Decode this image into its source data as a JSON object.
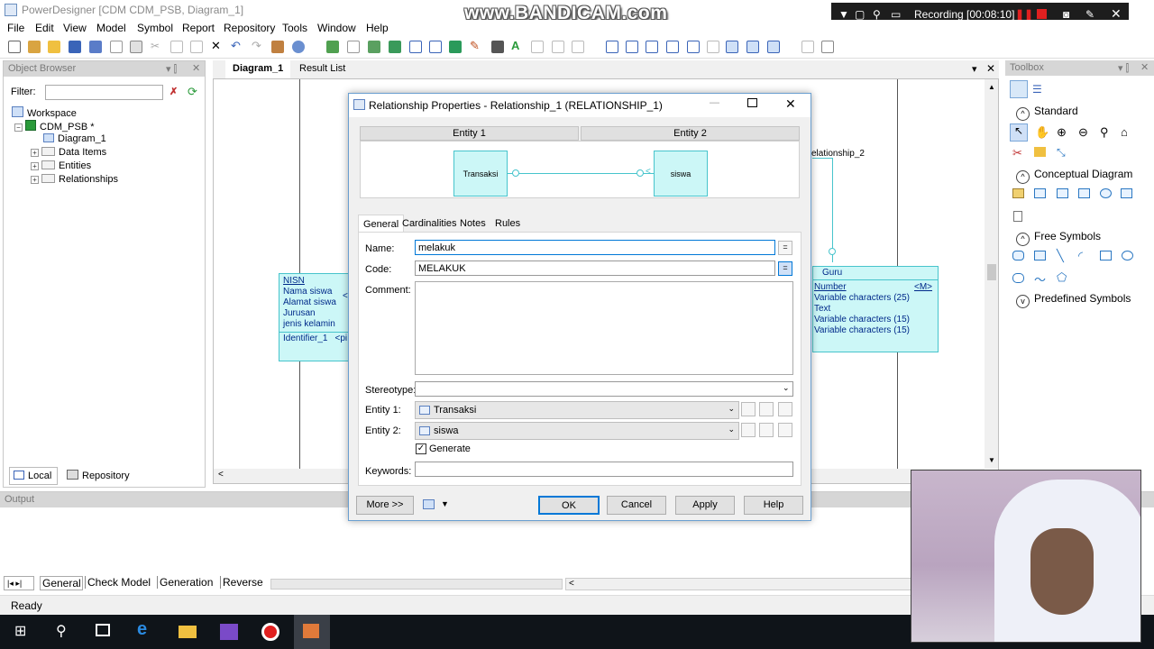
{
  "window": {
    "title": "PowerDesigner [CDM CDM_PSB, Diagram_1]"
  },
  "watermark": "www.BANDICAM.com",
  "recording": {
    "label": "Recording [00:08:10]"
  },
  "menu": [
    "File",
    "Edit",
    "View",
    "Model",
    "Symbol",
    "Report",
    "Repository",
    "Tools",
    "Window",
    "Help"
  ],
  "object_browser": {
    "title": "Object Browser",
    "filter_label": "Filter:",
    "filter_value": "",
    "tree": {
      "workspace": "Workspace",
      "model": "CDM_PSB *",
      "diagram": "Diagram_1",
      "data_items": "Data Items",
      "entities": "Entities",
      "relationships": "Relationships"
    },
    "tabs": {
      "local": "Local",
      "repository": "Repository"
    }
  },
  "diagram": {
    "tabs": [
      "Diagram_1",
      "Result List"
    ],
    "left_entity": {
      "attrs": [
        "NISN",
        "Nama siswa",
        "Alamat siswa",
        "Jurusan",
        "jenis kelamin"
      ],
      "identifier": "Identifier_1",
      "identifier_tag": "<pi",
      "pk_tag": "<"
    },
    "right_entity": {
      "name": "Guru",
      "types": [
        "Number",
        "Variable characters (25)",
        "Text",
        "Variable characters (15)",
        "Variable characters (15)"
      ],
      "mandatory_tag": "<M>"
    },
    "rel_label": "elationship_2"
  },
  "toolbox": {
    "title": "Toolbox",
    "sections": [
      "Standard",
      "Conceptual Diagram",
      "Free Symbols",
      "Predefined Symbols"
    ]
  },
  "output": {
    "title": "Output",
    "tabs": [
      "General",
      "Check Model",
      "Generation",
      "Reverse"
    ]
  },
  "status": "Ready",
  "dialog": {
    "title": "Relationship Properties - Relationship_1 (RELATIONSHIP_1)",
    "entity1_header": "Entity 1",
    "entity2_header": "Entity 2",
    "preview_entity1": "Transaksi",
    "preview_entity2": "siswa",
    "tabs": [
      "General",
      "Cardinalities",
      "Notes",
      "Rules"
    ],
    "labels": {
      "name": "Name:",
      "code": "Code:",
      "comment": "Comment:",
      "stereotype": "Stereotype:",
      "entity1": "Entity 1:",
      "entity2": "Entity 2:",
      "keywords": "Keywords:"
    },
    "name_value": "melakuk",
    "code_value": "MELAKUK",
    "comment_value": "",
    "stereotype_value": "",
    "entity1_value": "Transaksi",
    "entity2_value": "siswa",
    "generate_label": "Generate",
    "generate_checked": true,
    "keywords_value": "",
    "buttons": {
      "more": "More >>",
      "ok": "OK",
      "cancel": "Cancel",
      "apply": "Apply",
      "help": "Help"
    },
    "eq_symbol": "="
  },
  "colors": {
    "entity_fill": "#ccf7f7",
    "entity_border": "#47c4cc",
    "accent": "#0078d7",
    "recording_bg": "#1d1d1d"
  }
}
